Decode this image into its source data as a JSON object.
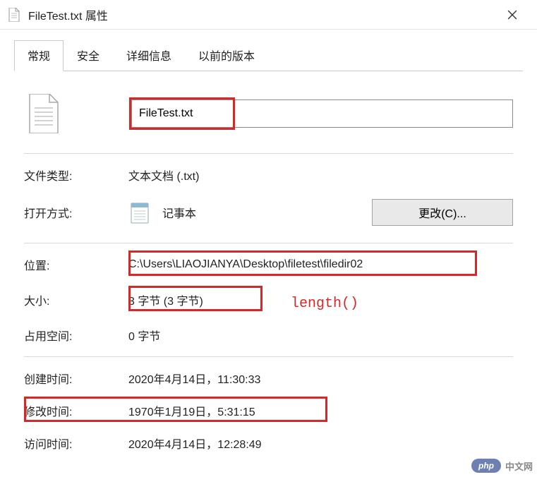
{
  "window": {
    "title": "FileTest.txt 属性",
    "close_tooltip": "关闭"
  },
  "tabs": [
    {
      "label": "常规",
      "active": true
    },
    {
      "label": "安全",
      "active": false
    },
    {
      "label": "详细信息",
      "active": false
    },
    {
      "label": "以前的版本",
      "active": false
    }
  ],
  "file": {
    "name": "FileTest.txt"
  },
  "labels": {
    "file_type": "文件类型:",
    "open_with": "打开方式:",
    "location": "位置:",
    "size": "大小:",
    "size_on_disk": "占用空间:",
    "created": "创建时间:",
    "modified": "修改时间:",
    "accessed": "访问时间:"
  },
  "values": {
    "file_type": "文本文档 (.txt)",
    "open_with": "记事本",
    "location": "C:\\Users\\LIAOJIANYA\\Desktop\\filetest\\filedir02",
    "size": "3 字节 (3 字节)",
    "size_on_disk": "0 字节",
    "created": "2020年4月14日，11:30:33",
    "modified": "1970年1月19日，5:31:15",
    "accessed": "2020年4月14日，12:28:49"
  },
  "buttons": {
    "change": "更改(C)..."
  },
  "annotations": {
    "length_note": "length()"
  },
  "colors": {
    "highlight": "#d62828"
  },
  "watermark": {
    "badge": "php",
    "text": "中文网"
  }
}
